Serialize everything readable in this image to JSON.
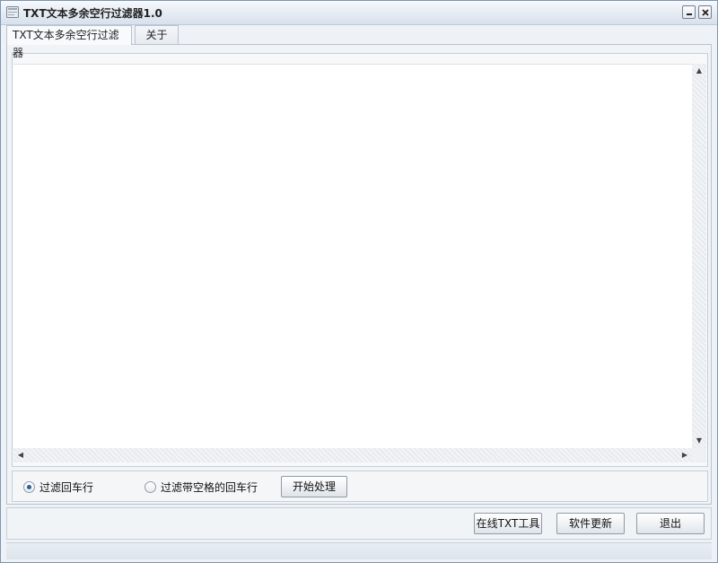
{
  "window": {
    "title": "TXT文本多余空行过滤器1.0"
  },
  "tabs": [
    {
      "label": "TXT文本多余空行过滤器",
      "active": true
    },
    {
      "label": "关于",
      "active": false
    }
  ],
  "editor": {
    "value": ""
  },
  "options": {
    "radio_filter_newline": {
      "label": "过滤回车行",
      "checked": true
    },
    "radio_filter_space_newline": {
      "label": "过滤带空格的回车行",
      "checked": false
    },
    "start_label": "开始处理"
  },
  "buttons": {
    "online_tools": "在线TXT工具",
    "update": "软件更新",
    "exit": "退出"
  },
  "icons": {
    "app": "app-icon",
    "minimize": "minimize-icon",
    "close": "close-icon"
  }
}
